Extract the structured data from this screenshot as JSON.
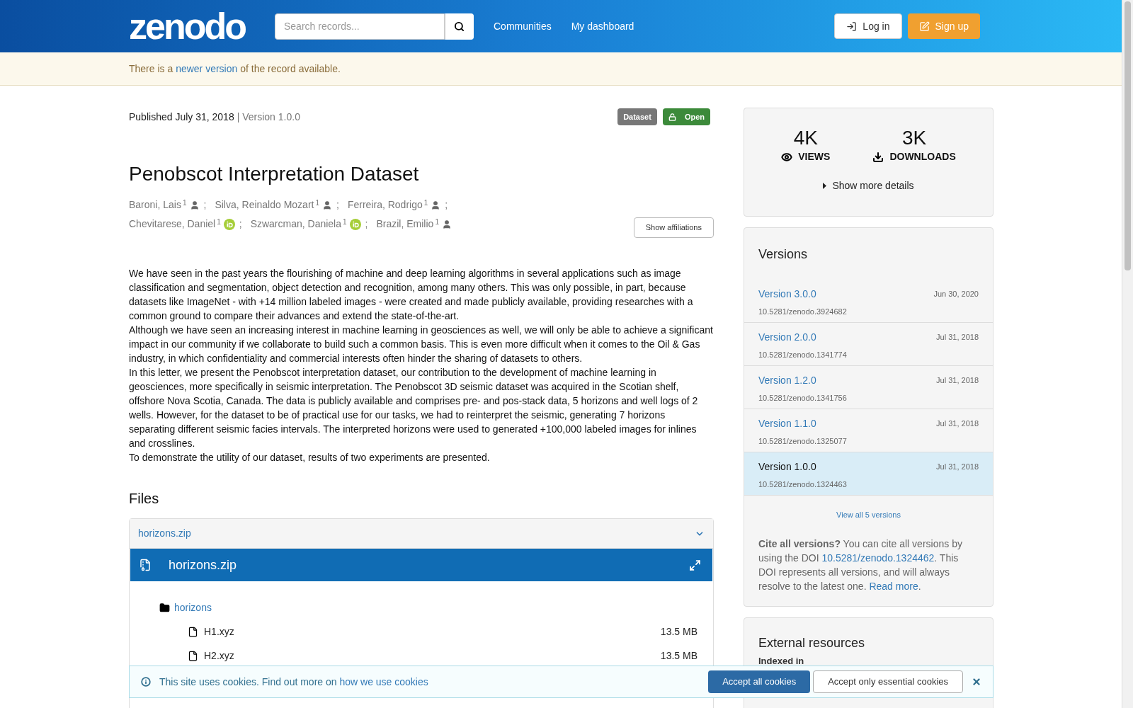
{
  "header": {
    "logo": "zenodo",
    "search": {
      "placeholder": "Search records..."
    },
    "nav": [
      "Communities",
      "My dashboard"
    ],
    "login": "Log in",
    "signup": "Sign up"
  },
  "notice": {
    "before": "There is a ",
    "link": "newer version",
    "after": " of the record available."
  },
  "record": {
    "published": "Published July 31, 2018",
    "version": "| Version 1.0.0",
    "badges": [
      {
        "label": "Dataset",
        "kind": "type"
      },
      {
        "label": "Open",
        "kind": "access"
      }
    ],
    "title": "Penobscot Interpretation Dataset",
    "authors": [
      {
        "name": "Baroni, Lais",
        "affiliation": "1",
        "kind": "person",
        "separator": ";"
      },
      {
        "name": "Silva, Reinaldo Mozart",
        "affiliation": "1",
        "kind": "person",
        "separator": ";"
      },
      {
        "name": "Ferreira, Rodrigo",
        "affiliation": "1",
        "kind": "person",
        "separator": ";"
      },
      {
        "name": "Chevitarese, Daniel",
        "affiliation": "1",
        "kind": "orcid",
        "separator": ";"
      },
      {
        "name": "Szwarcman, Daniela",
        "affiliation": "1",
        "kind": "orcid",
        "separator": ";"
      },
      {
        "name": "Brazil, Emilio",
        "affiliation": "1",
        "kind": "person"
      }
    ],
    "show_affiliations": "Show affiliations",
    "description": [
      "We have seen in the past years the flourishing of machine and deep learning algorithms in several applications such as image classification and segmentation, object detection and recognition, among many others. This was only possible, in part, because datasets like ImageNet - with +14 million labeled images - were created and made publicly available, providing researches with a common ground to compare their advances and extend the state-of-the-art.",
      "Although we have seen an increasing interest in machine learning in geosciences as well, we will only be able to achieve a significant impact in our community if we collaborate to build such a common basis. This is even more difficult when it comes to the Oil & Gas industry, in which confidentiality and commercial interests often hinder the sharing of datasets to others.",
      "In this letter, we present the Penobscot interpretation dataset, our contribution to the development of machine learning in geosciences, more specifically in seismic interpretation. The Penobscot 3D seismic dataset was acquired in the Scotian shelf, offshore Nova Scotia, Canada. The data is publicly available and comprises pre- and pos-stack data, 5 horizons and well logs of 2 wells. However, for the dataset to be of practical use for our tasks, we had to reinterpret the seismic, generating 7 horizons separating different seismic facies intervals. The interpreted horizons were used to generated +100,000 labeled images for inlines and crosslines.",
      "To demonstrate the utility of our dataset, results of two experiments are presented."
    ]
  },
  "files": {
    "heading": "Files",
    "panel_title": "horizons.zip",
    "expanded": true,
    "preview_title": "horizons.zip",
    "tree": [
      {
        "name": "horizons",
        "kind": "folder",
        "children": [
          {
            "name": "H1.xyz",
            "size": "13.5 MB",
            "kind": "file"
          },
          {
            "name": "H2.xyz",
            "size": "13.5 MB",
            "kind": "file"
          }
        ]
      }
    ]
  },
  "stats": [
    {
      "value": "4K",
      "label": "VIEWS",
      "kind": "views"
    },
    {
      "value": "3K",
      "label": "DOWNLOADS",
      "kind": "downloads"
    }
  ],
  "show_more": "Show more details",
  "versions": {
    "heading": "Versions",
    "items": [
      {
        "label": "Version 3.0.0",
        "date": "Jun 30, 2020",
        "doi": "10.5281/zenodo.3924682",
        "selected": false
      },
      {
        "label": "Version 2.0.0",
        "date": "Jul 31, 2018",
        "doi": "10.5281/zenodo.1341774",
        "selected": false
      },
      {
        "label": "Version 1.2.0",
        "date": "Jul 31, 2018",
        "doi": "10.5281/zenodo.1341756",
        "selected": false
      },
      {
        "label": "Version 1.1.0",
        "date": "Jul 31, 2018",
        "doi": "10.5281/zenodo.1325077",
        "selected": false
      },
      {
        "label": "Version 1.0.0",
        "date": "Jul 31, 2018",
        "doi": "10.5281/zenodo.1324463",
        "selected": true
      }
    ],
    "view_all": "View all 5 versions",
    "cite": {
      "bold": "Cite all versions?",
      "before": " You can cite all versions by using the DOI ",
      "doi": "10.5281/zenodo.1324462",
      "middle": ". This DOI represents all versions, and will always resolve to the latest one. ",
      "link": "Read more",
      "after": "."
    }
  },
  "external": {
    "heading": "External resources",
    "indexed": "Indexed in"
  },
  "cookies": {
    "before": "This site uses cookies. Find out more on ",
    "link": "how we use cookies",
    "accept_all": "Accept all cookies",
    "accept_essential": "Accept only essential cookies"
  }
}
